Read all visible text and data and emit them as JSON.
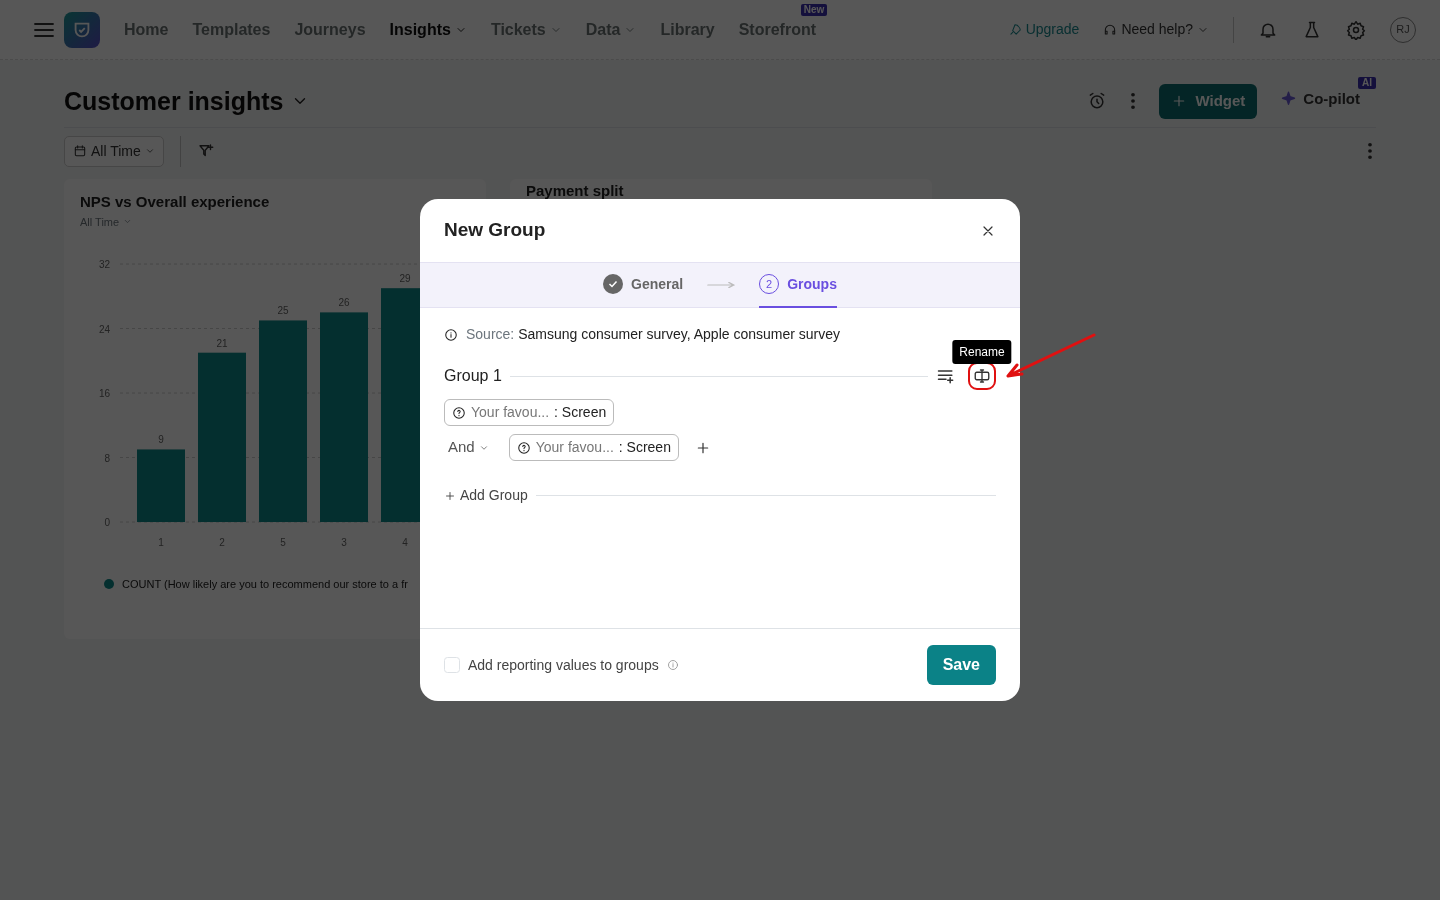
{
  "nav": {
    "items": [
      {
        "label": "Home",
        "selected": false,
        "dropdown": false
      },
      {
        "label": "Templates",
        "selected": false,
        "dropdown": false
      },
      {
        "label": "Journeys",
        "selected": false,
        "dropdown": false
      },
      {
        "label": "Insights",
        "selected": true,
        "dropdown": true
      },
      {
        "label": "Tickets",
        "selected": false,
        "dropdown": true
      },
      {
        "label": "Data",
        "selected": false,
        "dropdown": true
      },
      {
        "label": "Library",
        "selected": false,
        "dropdown": false
      },
      {
        "label": "Storefront",
        "selected": false,
        "dropdown": false,
        "badge": "New"
      }
    ],
    "upgrade": "Upgrade",
    "help": "Need help?",
    "avatar": "RJ"
  },
  "page": {
    "title": "Customer insights",
    "date_filter": "All Time",
    "widget_button": "Widget",
    "copilot": {
      "label": "Co-pilot",
      "badge": "AI"
    }
  },
  "cards": [
    {
      "title": "NPS vs Overall experience",
      "subtitle": "All Time",
      "chart_data": {
        "type": "bar",
        "categories": [
          "1",
          "2",
          "5",
          "3",
          "4"
        ],
        "series": [
          {
            "name": "COUNT (How likely are you to recommend our store to a fr",
            "color": "#0d8a8a",
            "values": [
              9,
              21,
              25,
              26,
              29
            ]
          }
        ],
        "ylim": [
          0,
          32
        ],
        "yticks": [
          0,
          8,
          16,
          24,
          32
        ],
        "grid": true,
        "data_labels": true
      }
    },
    {
      "title": "Payment split"
    }
  ],
  "modal": {
    "title": "New Group",
    "steps": [
      {
        "label": "General",
        "done": true,
        "selected": false
      },
      {
        "label": "Groups",
        "number": "2",
        "done": false,
        "selected": true
      }
    ],
    "source_label": "Source:",
    "source_value": "Samsung consumer survey, Apple consumer survey",
    "groups": [
      {
        "name": "Group 1",
        "conditions": [
          {
            "question": "Your favou...",
            "value": ": Screen"
          },
          {
            "connector": "And",
            "question": "Your favou...",
            "value": ": Screen"
          }
        ]
      }
    ],
    "tooltip": "Rename",
    "add_group": "Add Group",
    "checkbox": {
      "label": "Add reporting values to groups",
      "checked": false
    },
    "save": "Save"
  }
}
